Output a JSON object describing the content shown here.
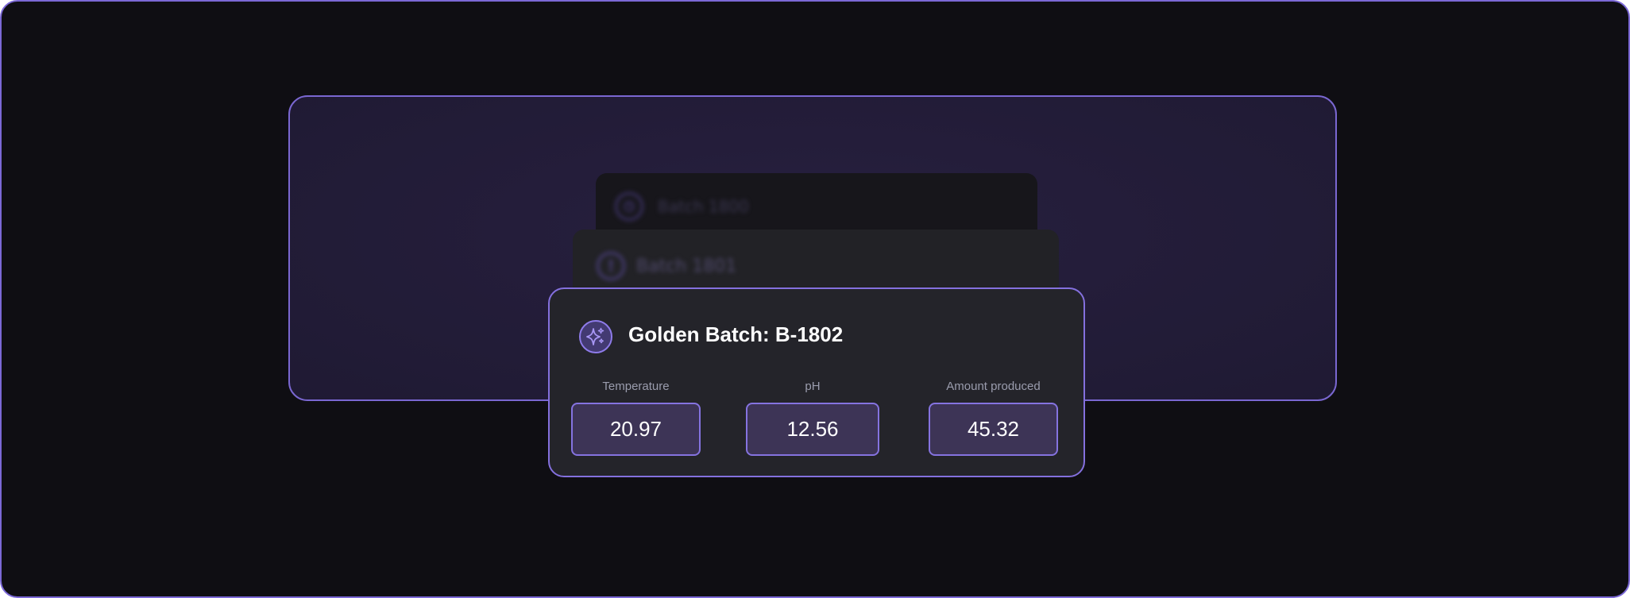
{
  "ghost_batches": [
    {
      "label": "Batch 1800",
      "icon": "clock-icon"
    },
    {
      "label": "Batch 1801",
      "icon": "alert-icon"
    }
  ],
  "golden_batch": {
    "title": "Golden Batch: B-1802",
    "icon": "sparkle-icon",
    "metrics": [
      {
        "label": "Temperature",
        "value": "20.97"
      },
      {
        "label": "pH",
        "value": "12.56"
      },
      {
        "label": "Amount produced",
        "value": "45.32"
      }
    ]
  },
  "colors": {
    "accent": "#8470de",
    "background": "#0f0e13",
    "card": "#24242a",
    "metric_fill": "#3d3456"
  }
}
